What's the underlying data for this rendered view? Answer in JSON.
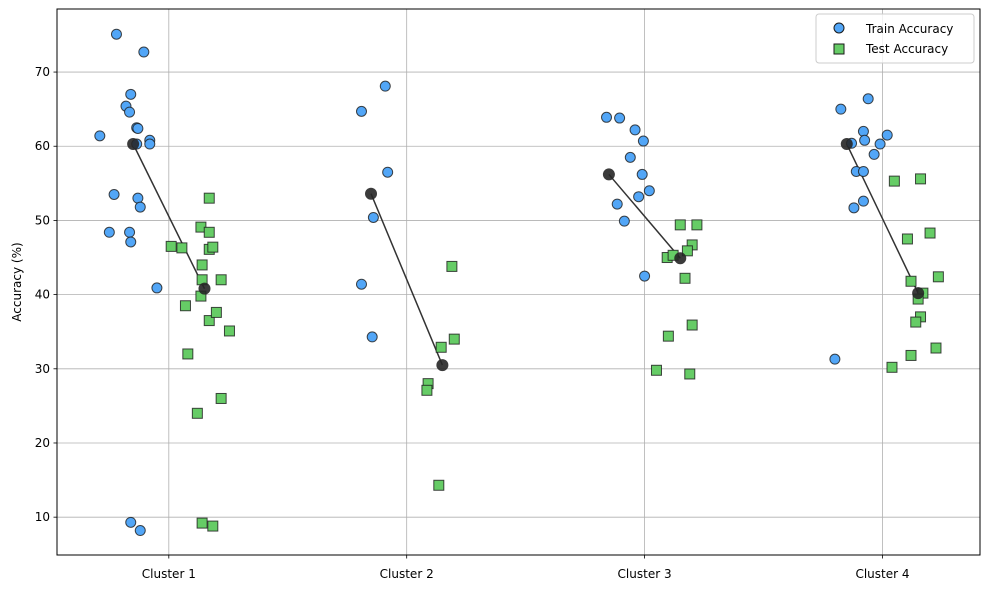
{
  "chart_data": {
    "type": "scatter",
    "title": "",
    "xlabel": "",
    "ylabel": "Accuracy (%)",
    "categories": [
      "Cluster 1",
      "Cluster 2",
      "Cluster 3",
      "Cluster 4"
    ],
    "xlim": [
      -0.47,
      3.41
    ],
    "ylim": [
      4.9,
      78.5
    ],
    "yticks": [
      10,
      20,
      30,
      40,
      50,
      60,
      70
    ],
    "grid": true,
    "legend_position": "top-right",
    "colors": {
      "train_fill": "#52a6f7",
      "test_fill": "#66cc66",
      "marker_edge": "#1a1a1a",
      "mean_marker": "#262626",
      "mean_line": "#333333",
      "grid": "#b0b0b0"
    },
    "series": [
      {
        "name": "Train Accuracy",
        "marker": "circle",
        "points": [
          {
            "cluster": 0,
            "x": -0.22,
            "y": 75.1
          },
          {
            "cluster": 0,
            "x": -0.105,
            "y": 72.7
          },
          {
            "cluster": 0,
            "x": -0.16,
            "y": 67.0
          },
          {
            "cluster": 0,
            "x": -0.18,
            "y": 65.4
          },
          {
            "cluster": 0,
            "x": -0.165,
            "y": 64.6
          },
          {
            "cluster": 0,
            "x": -0.135,
            "y": 62.5
          },
          {
            "cluster": 0,
            "x": -0.13,
            "y": 62.4
          },
          {
            "cluster": 0,
            "x": -0.29,
            "y": 61.4
          },
          {
            "cluster": 0,
            "x": -0.08,
            "y": 60.8
          },
          {
            "cluster": 0,
            "x": -0.08,
            "y": 60.3
          },
          {
            "cluster": 0,
            "x": -0.135,
            "y": 60.3
          },
          {
            "cluster": 0,
            "x": -0.23,
            "y": 53.5
          },
          {
            "cluster": 0,
            "x": -0.13,
            "y": 53.0
          },
          {
            "cluster": 0,
            "x": -0.12,
            "y": 51.8
          },
          {
            "cluster": 0,
            "x": -0.25,
            "y": 48.4
          },
          {
            "cluster": 0,
            "x": -0.165,
            "y": 48.4
          },
          {
            "cluster": 0,
            "x": -0.16,
            "y": 47.1
          },
          {
            "cluster": 0,
            "x": -0.05,
            "y": 40.9
          },
          {
            "cluster": 0,
            "x": -0.16,
            "y": 9.3
          },
          {
            "cluster": 0,
            "x": -0.12,
            "y": 8.2
          },
          {
            "cluster": 1,
            "x": 0.91,
            "y": 68.1
          },
          {
            "cluster": 1,
            "x": 0.81,
            "y": 64.7
          },
          {
            "cluster": 1,
            "x": 0.92,
            "y": 56.5
          },
          {
            "cluster": 1,
            "x": 0.86,
            "y": 50.4
          },
          {
            "cluster": 1,
            "x": 0.81,
            "y": 41.4
          },
          {
            "cluster": 1,
            "x": 0.855,
            "y": 34.3
          },
          {
            "cluster": 2,
            "x": 1.84,
            "y": 63.9
          },
          {
            "cluster": 2,
            "x": 1.895,
            "y": 63.8
          },
          {
            "cluster": 2,
            "x": 1.96,
            "y": 62.2
          },
          {
            "cluster": 2,
            "x": 1.995,
            "y": 60.7
          },
          {
            "cluster": 2,
            "x": 1.94,
            "y": 58.5
          },
          {
            "cluster": 2,
            "x": 1.99,
            "y": 56.2
          },
          {
            "cluster": 2,
            "x": 2.02,
            "y": 54.0
          },
          {
            "cluster": 2,
            "x": 1.975,
            "y": 53.2
          },
          {
            "cluster": 2,
            "x": 1.885,
            "y": 52.2
          },
          {
            "cluster": 2,
            "x": 1.915,
            "y": 49.9
          },
          {
            "cluster": 2,
            "x": 2.0,
            "y": 42.5
          },
          {
            "cluster": 3,
            "x": 2.94,
            "y": 66.4
          },
          {
            "cluster": 3,
            "x": 2.825,
            "y": 65.0
          },
          {
            "cluster": 3,
            "x": 2.92,
            "y": 62.0
          },
          {
            "cluster": 3,
            "x": 3.02,
            "y": 61.5
          },
          {
            "cluster": 3,
            "x": 2.87,
            "y": 60.4
          },
          {
            "cluster": 3,
            "x": 2.925,
            "y": 60.8
          },
          {
            "cluster": 3,
            "x": 2.99,
            "y": 60.3
          },
          {
            "cluster": 3,
            "x": 2.965,
            "y": 58.9
          },
          {
            "cluster": 3,
            "x": 2.89,
            "y": 56.6
          },
          {
            "cluster": 3,
            "x": 2.92,
            "y": 56.6
          },
          {
            "cluster": 3,
            "x": 2.92,
            "y": 52.6
          },
          {
            "cluster": 3,
            "x": 2.88,
            "y": 51.7
          },
          {
            "cluster": 3,
            "x": 2.8,
            "y": 31.3
          }
        ]
      },
      {
        "name": "Test Accuracy",
        "marker": "square",
        "points": [
          {
            "cluster": 0,
            "x": 0.01,
            "y": 46.5
          },
          {
            "cluster": 0,
            "x": 0.055,
            "y": 46.3
          },
          {
            "cluster": 0,
            "x": 0.07,
            "y": 38.5
          },
          {
            "cluster": 0,
            "x": 0.08,
            "y": 32.0
          },
          {
            "cluster": 0,
            "x": 0.12,
            "y": 24.0
          },
          {
            "cluster": 0,
            "x": 0.135,
            "y": 49.1
          },
          {
            "cluster": 0,
            "x": 0.14,
            "y": 44.0
          },
          {
            "cluster": 0,
            "x": 0.14,
            "y": 42.0
          },
          {
            "cluster": 0,
            "x": 0.135,
            "y": 39.8
          },
          {
            "cluster": 0,
            "x": 0.14,
            "y": 9.2
          },
          {
            "cluster": 0,
            "x": 0.17,
            "y": 53.0
          },
          {
            "cluster": 0,
            "x": 0.17,
            "y": 48.4
          },
          {
            "cluster": 0,
            "x": 0.17,
            "y": 46.1
          },
          {
            "cluster": 0,
            "x": 0.185,
            "y": 46.4
          },
          {
            "cluster": 0,
            "x": 0.17,
            "y": 36.5
          },
          {
            "cluster": 0,
            "x": 0.2,
            "y": 37.6
          },
          {
            "cluster": 0,
            "x": 0.22,
            "y": 42.0
          },
          {
            "cluster": 0,
            "x": 0.22,
            "y": 26.0
          },
          {
            "cluster": 0,
            "x": 0.255,
            "y": 35.1
          },
          {
            "cluster": 0,
            "x": 0.185,
            "y": 8.8
          },
          {
            "cluster": 1,
            "x": 1.19,
            "y": 43.8
          },
          {
            "cluster": 1,
            "x": 1.145,
            "y": 32.9
          },
          {
            "cluster": 1,
            "x": 1.2,
            "y": 34.0
          },
          {
            "cluster": 1,
            "x": 1.09,
            "y": 28.0
          },
          {
            "cluster": 1,
            "x": 1.085,
            "y": 27.1
          },
          {
            "cluster": 1,
            "x": 1.135,
            "y": 14.3
          },
          {
            "cluster": 2,
            "x": 2.15,
            "y": 49.4
          },
          {
            "cluster": 2,
            "x": 2.22,
            "y": 49.4
          },
          {
            "cluster": 2,
            "x": 2.2,
            "y": 46.7
          },
          {
            "cluster": 2,
            "x": 2.18,
            "y": 45.9
          },
          {
            "cluster": 2,
            "x": 2.095,
            "y": 45.0
          },
          {
            "cluster": 2,
            "x": 2.12,
            "y": 45.3
          },
          {
            "cluster": 2,
            "x": 2.17,
            "y": 42.2
          },
          {
            "cluster": 2,
            "x": 2.1,
            "y": 34.4
          },
          {
            "cluster": 2,
            "x": 2.2,
            "y": 35.9
          },
          {
            "cluster": 2,
            "x": 2.05,
            "y": 29.8
          },
          {
            "cluster": 2,
            "x": 2.19,
            "y": 29.3
          },
          {
            "cluster": 3,
            "x": 3.05,
            "y": 55.3
          },
          {
            "cluster": 3,
            "x": 3.16,
            "y": 55.6
          },
          {
            "cluster": 3,
            "x": 3.105,
            "y": 47.5
          },
          {
            "cluster": 3,
            "x": 3.2,
            "y": 48.3
          },
          {
            "cluster": 3,
            "x": 3.12,
            "y": 41.8
          },
          {
            "cluster": 3,
            "x": 3.235,
            "y": 42.4
          },
          {
            "cluster": 3,
            "x": 3.17,
            "y": 40.2
          },
          {
            "cluster": 3,
            "x": 3.15,
            "y": 39.4
          },
          {
            "cluster": 3,
            "x": 3.16,
            "y": 37.0
          },
          {
            "cluster": 3,
            "x": 3.14,
            "y": 36.3
          },
          {
            "cluster": 3,
            "x": 3.12,
            "y": 31.8
          },
          {
            "cluster": 3,
            "x": 3.225,
            "y": 32.8
          },
          {
            "cluster": 3,
            "x": 3.04,
            "y": 30.2
          }
        ]
      }
    ],
    "means": [
      {
        "cluster": "Cluster 1",
        "train": {
          "x": -0.15,
          "y": 60.3
        },
        "test": {
          "x": 0.15,
          "y": 40.8
        }
      },
      {
        "cluster": "Cluster 2",
        "train": {
          "x": 0.85,
          "y": 53.6
        },
        "test": {
          "x": 1.15,
          "y": 30.5
        }
      },
      {
        "cluster": "Cluster 3",
        "train": {
          "x": 1.85,
          "y": 56.2
        },
        "test": {
          "x": 2.15,
          "y": 44.9
        }
      },
      {
        "cluster": "Cluster 4",
        "train": {
          "x": 2.85,
          "y": 60.3
        },
        "test": {
          "x": 3.15,
          "y": 40.2
        }
      }
    ]
  }
}
